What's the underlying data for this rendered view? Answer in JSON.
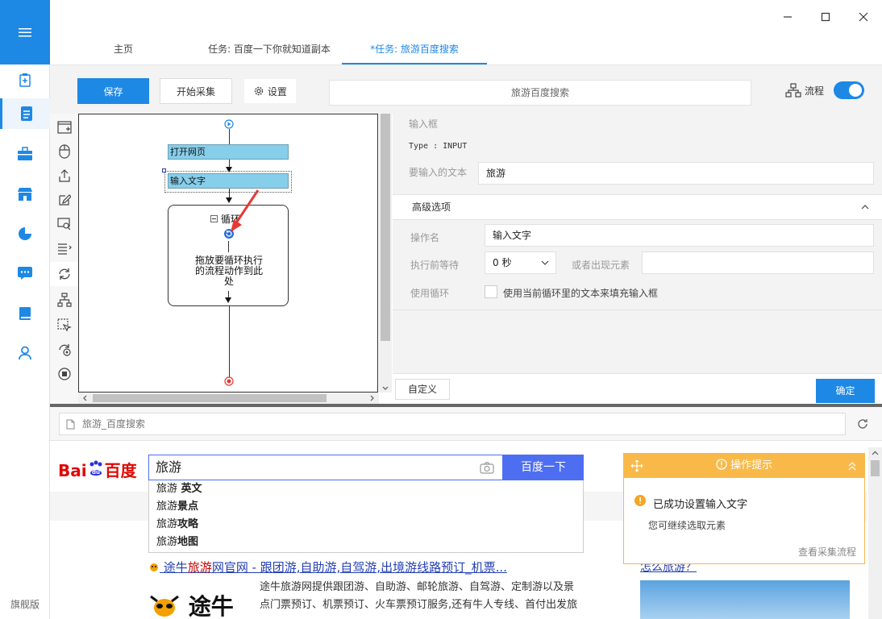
{
  "sidebar": {
    "edition": "旗舰版",
    "menu_icon": "hamburger-icon",
    "icons": [
      "new-task-icon",
      "tasks-icon",
      "toolbox-icon",
      "market-icon",
      "chart-icon",
      "message-icon",
      "book-icon",
      "user-icon"
    ]
  },
  "tabs": [
    {
      "label": "主页"
    },
    {
      "label": "任务: 百度一下你就知道副本"
    },
    {
      "label": "*任务: 旅游百度搜索"
    }
  ],
  "toolbar": {
    "save_label": "保存",
    "start_label": "开始采集",
    "settings_label": "设置",
    "task_name": "旅游百度搜索",
    "flow_label": "流程"
  },
  "flow": {
    "open_page": "打开网页",
    "input_text": "输入文字",
    "loop_label": "循环",
    "loop_hint": "拖放要循环执行的流程动作到此处"
  },
  "props": {
    "section_title": "输入框",
    "type_text": "Type : INPUT",
    "text_label": "要输入的文本",
    "text_value": "旅游",
    "advanced_title": "高级选项",
    "op_name_label": "操作名",
    "op_name_value": "输入文字",
    "wait_label": "执行前等待",
    "wait_value": "0 秒",
    "or_element_label": "或者出现元素",
    "or_element_value": "",
    "loop_label": "使用循环",
    "loop_checkbox_label": "使用当前循环里的文本来填充输入框",
    "custom_label": "自定义",
    "ok_label": "确定"
  },
  "browser": {
    "address": "旅游_百度搜索"
  },
  "web": {
    "logo_text_1": "Bai",
    "logo_text_2": "百度",
    "search_value": "旅游",
    "search_button": "百度一下",
    "suggestions": [
      {
        "prefix": "旅游",
        "bold": " 英文"
      },
      {
        "prefix": "旅游",
        "bold": "景点"
      },
      {
        "prefix": "旅游",
        "bold": "攻略"
      },
      {
        "prefix": "旅游",
        "bold": "地图"
      }
    ],
    "result_title_a": "途牛",
    "result_title_b": "旅游",
    "result_title_c": "网官网 - 跟团游,自助游,自驾游,出境游线路预订_机票...",
    "result_desc": "途牛旅游网提供跟团游、自助游、邮轮旅游、自驾游、定制游以及景点门票预订、机票预订、火车票预订服务,还有牛人专线、首付出发旅",
    "tuniu_logo": "途牛",
    "side_link": "怎么旅游？"
  },
  "tip": {
    "title": "操作提示",
    "message": "已成功设置输入文字",
    "sub": "您可继续选取元素",
    "link": "查看采集流程"
  },
  "colors": {
    "accent": "#1e88e5",
    "node": "#87ceeb",
    "tip": "#f9b949",
    "baidu_blue": "#4e6ef2",
    "baidu_red": "#e10602"
  }
}
